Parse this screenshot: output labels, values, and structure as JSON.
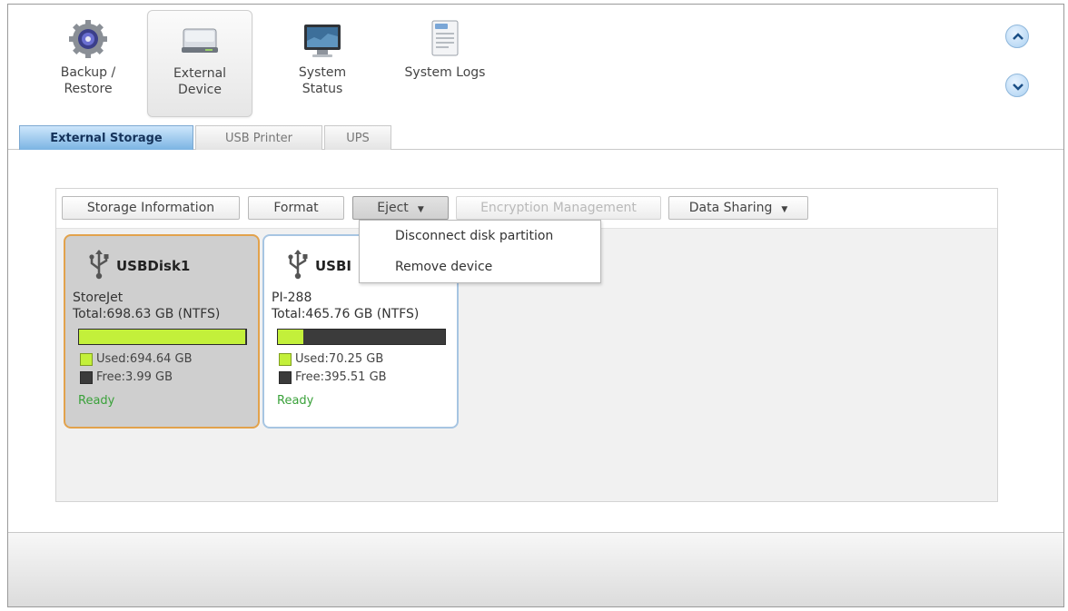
{
  "nav": {
    "items": [
      {
        "label": "Backup /\nRestore",
        "icon": "gear-disc-icon"
      },
      {
        "label": "External\nDevice",
        "icon": "external-drive-icon"
      },
      {
        "label": "System\nStatus",
        "icon": "monitor-icon"
      },
      {
        "label": "System Logs",
        "icon": "log-document-icon"
      }
    ],
    "active_index": 1
  },
  "tabs": [
    {
      "label": "External Storage"
    },
    {
      "label": "USB Printer"
    },
    {
      "label": "UPS"
    }
  ],
  "toolbar": {
    "storage_info": "Storage Information",
    "format": "Format",
    "eject": "Eject",
    "encryption": "Encryption Management",
    "data_sharing": "Data Sharing"
  },
  "eject_menu": {
    "items": [
      "Disconnect disk partition",
      "Remove device"
    ]
  },
  "disks": [
    {
      "name": "USBDisk1",
      "vendor": "StoreJet",
      "total": "Total:698.63 GB (NTFS)",
      "used": "Used:694.64 GB",
      "free": "Free:3.99 GB",
      "used_fraction": 0.994,
      "status": "Ready"
    },
    {
      "name": "USBDisk2",
      "name_visible": "USBI",
      "vendor": "PI-288",
      "total": "Total:465.76 GB (NTFS)",
      "used": "Used:70.25 GB",
      "free": "Free:395.51 GB",
      "used_fraction": 0.151,
      "status": "Ready"
    }
  ],
  "colors": {
    "accent_blue": "#7bb4e3",
    "used_green": "#c3f03a",
    "free_dark": "#3b3b3b",
    "selected_border": "#e2a24c",
    "status_green": "#3aa13a"
  }
}
